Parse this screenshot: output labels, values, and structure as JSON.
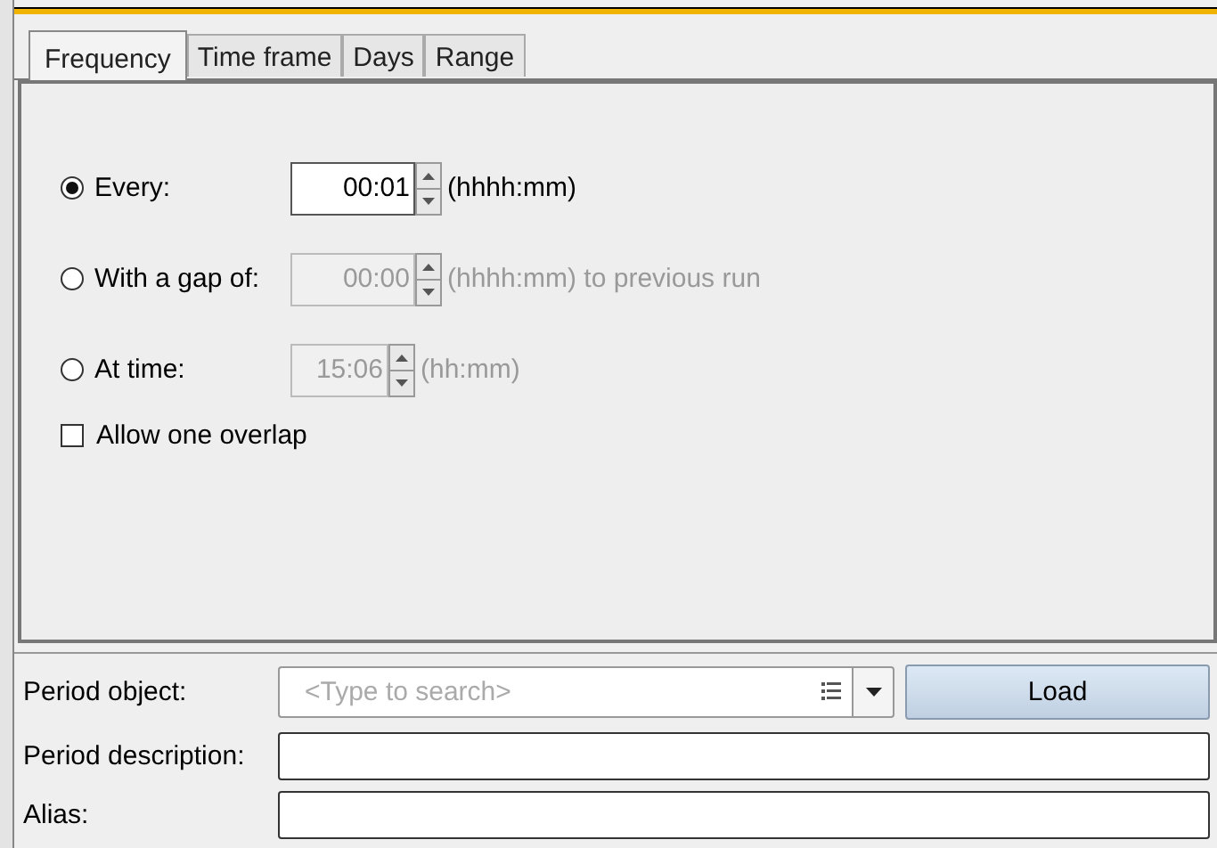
{
  "tabs": [
    {
      "label": "Frequency",
      "selected": true
    },
    {
      "label": "Time frame",
      "selected": false
    },
    {
      "label": "Days",
      "selected": false
    },
    {
      "label": "Range",
      "selected": false
    }
  ],
  "options": [
    {
      "label": "Every:",
      "selected": true,
      "disabled": false,
      "kind": "duration",
      "value": "00:01",
      "unit": "(hhhh:mm)"
    },
    {
      "label": "With a gap of:",
      "selected": false,
      "disabled": true,
      "kind": "duration",
      "value": "00:00",
      "unit": "(hhhh:mm) to previous run"
    },
    {
      "label": "At time:",
      "selected": false,
      "disabled": true,
      "kind": "clock",
      "value": "15:06",
      "unit": "(hh:mm)"
    }
  ],
  "overlap": {
    "label": "Allow one overlap",
    "checked": false
  },
  "period_object": {
    "label": "Period object:",
    "placeholder": "<Type to search>"
  },
  "load_button": "Load",
  "fields": [
    {
      "label": "Period description:"
    },
    {
      "label": "Alias:"
    }
  ]
}
